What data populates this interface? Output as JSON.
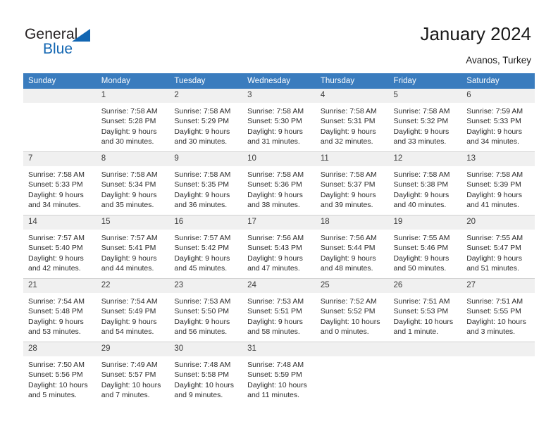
{
  "brand": {
    "name_part1": "General",
    "name_part2": "Blue",
    "accent_color": "#1266b2"
  },
  "header": {
    "title": "January 2024",
    "subtitle": "Avanos, Turkey",
    "header_bg_color": "#3a7cbe"
  },
  "weekdays": [
    "Sunday",
    "Monday",
    "Tuesday",
    "Wednesday",
    "Thursday",
    "Friday",
    "Saturday"
  ],
  "weeks": [
    [
      {
        "day": "",
        "empty": true
      },
      {
        "day": "1",
        "sunrise": "Sunrise: 7:58 AM",
        "sunset": "Sunset: 5:28 PM",
        "daylight": "Daylight: 9 hours and 30 minutes."
      },
      {
        "day": "2",
        "sunrise": "Sunrise: 7:58 AM",
        "sunset": "Sunset: 5:29 PM",
        "daylight": "Daylight: 9 hours and 30 minutes."
      },
      {
        "day": "3",
        "sunrise": "Sunrise: 7:58 AM",
        "sunset": "Sunset: 5:30 PM",
        "daylight": "Daylight: 9 hours and 31 minutes."
      },
      {
        "day": "4",
        "sunrise": "Sunrise: 7:58 AM",
        "sunset": "Sunset: 5:31 PM",
        "daylight": "Daylight: 9 hours and 32 minutes."
      },
      {
        "day": "5",
        "sunrise": "Sunrise: 7:58 AM",
        "sunset": "Sunset: 5:32 PM",
        "daylight": "Daylight: 9 hours and 33 minutes."
      },
      {
        "day": "6",
        "sunrise": "Sunrise: 7:59 AM",
        "sunset": "Sunset: 5:33 PM",
        "daylight": "Daylight: 9 hours and 34 minutes."
      }
    ],
    [
      {
        "day": "7",
        "sunrise": "Sunrise: 7:58 AM",
        "sunset": "Sunset: 5:33 PM",
        "daylight": "Daylight: 9 hours and 34 minutes."
      },
      {
        "day": "8",
        "sunrise": "Sunrise: 7:58 AM",
        "sunset": "Sunset: 5:34 PM",
        "daylight": "Daylight: 9 hours and 35 minutes."
      },
      {
        "day": "9",
        "sunrise": "Sunrise: 7:58 AM",
        "sunset": "Sunset: 5:35 PM",
        "daylight": "Daylight: 9 hours and 36 minutes."
      },
      {
        "day": "10",
        "sunrise": "Sunrise: 7:58 AM",
        "sunset": "Sunset: 5:36 PM",
        "daylight": "Daylight: 9 hours and 38 minutes."
      },
      {
        "day": "11",
        "sunrise": "Sunrise: 7:58 AM",
        "sunset": "Sunset: 5:37 PM",
        "daylight": "Daylight: 9 hours and 39 minutes."
      },
      {
        "day": "12",
        "sunrise": "Sunrise: 7:58 AM",
        "sunset": "Sunset: 5:38 PM",
        "daylight": "Daylight: 9 hours and 40 minutes."
      },
      {
        "day": "13",
        "sunrise": "Sunrise: 7:58 AM",
        "sunset": "Sunset: 5:39 PM",
        "daylight": "Daylight: 9 hours and 41 minutes."
      }
    ],
    [
      {
        "day": "14",
        "sunrise": "Sunrise: 7:57 AM",
        "sunset": "Sunset: 5:40 PM",
        "daylight": "Daylight: 9 hours and 42 minutes."
      },
      {
        "day": "15",
        "sunrise": "Sunrise: 7:57 AM",
        "sunset": "Sunset: 5:41 PM",
        "daylight": "Daylight: 9 hours and 44 minutes."
      },
      {
        "day": "16",
        "sunrise": "Sunrise: 7:57 AM",
        "sunset": "Sunset: 5:42 PM",
        "daylight": "Daylight: 9 hours and 45 minutes."
      },
      {
        "day": "17",
        "sunrise": "Sunrise: 7:56 AM",
        "sunset": "Sunset: 5:43 PM",
        "daylight": "Daylight: 9 hours and 47 minutes."
      },
      {
        "day": "18",
        "sunrise": "Sunrise: 7:56 AM",
        "sunset": "Sunset: 5:44 PM",
        "daylight": "Daylight: 9 hours and 48 minutes."
      },
      {
        "day": "19",
        "sunrise": "Sunrise: 7:55 AM",
        "sunset": "Sunset: 5:46 PM",
        "daylight": "Daylight: 9 hours and 50 minutes."
      },
      {
        "day": "20",
        "sunrise": "Sunrise: 7:55 AM",
        "sunset": "Sunset: 5:47 PM",
        "daylight": "Daylight: 9 hours and 51 minutes."
      }
    ],
    [
      {
        "day": "21",
        "sunrise": "Sunrise: 7:54 AM",
        "sunset": "Sunset: 5:48 PM",
        "daylight": "Daylight: 9 hours and 53 minutes."
      },
      {
        "day": "22",
        "sunrise": "Sunrise: 7:54 AM",
        "sunset": "Sunset: 5:49 PM",
        "daylight": "Daylight: 9 hours and 54 minutes."
      },
      {
        "day": "23",
        "sunrise": "Sunrise: 7:53 AM",
        "sunset": "Sunset: 5:50 PM",
        "daylight": "Daylight: 9 hours and 56 minutes."
      },
      {
        "day": "24",
        "sunrise": "Sunrise: 7:53 AM",
        "sunset": "Sunset: 5:51 PM",
        "daylight": "Daylight: 9 hours and 58 minutes."
      },
      {
        "day": "25",
        "sunrise": "Sunrise: 7:52 AM",
        "sunset": "Sunset: 5:52 PM",
        "daylight": "Daylight: 10 hours and 0 minutes."
      },
      {
        "day": "26",
        "sunrise": "Sunrise: 7:51 AM",
        "sunset": "Sunset: 5:53 PM",
        "daylight": "Daylight: 10 hours and 1 minute."
      },
      {
        "day": "27",
        "sunrise": "Sunrise: 7:51 AM",
        "sunset": "Sunset: 5:55 PM",
        "daylight": "Daylight: 10 hours and 3 minutes."
      }
    ],
    [
      {
        "day": "28",
        "sunrise": "Sunrise: 7:50 AM",
        "sunset": "Sunset: 5:56 PM",
        "daylight": "Daylight: 10 hours and 5 minutes."
      },
      {
        "day": "29",
        "sunrise": "Sunrise: 7:49 AM",
        "sunset": "Sunset: 5:57 PM",
        "daylight": "Daylight: 10 hours and 7 minutes."
      },
      {
        "day": "30",
        "sunrise": "Sunrise: 7:48 AM",
        "sunset": "Sunset: 5:58 PM",
        "daylight": "Daylight: 10 hours and 9 minutes."
      },
      {
        "day": "31",
        "sunrise": "Sunrise: 7:48 AM",
        "sunset": "Sunset: 5:59 PM",
        "daylight": "Daylight: 10 hours and 11 minutes."
      },
      {
        "day": "",
        "empty": true
      },
      {
        "day": "",
        "empty": true
      },
      {
        "day": "",
        "empty": true
      }
    ]
  ]
}
